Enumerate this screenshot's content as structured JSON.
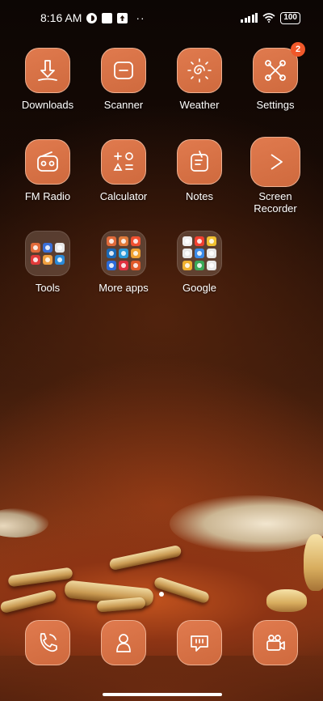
{
  "status_bar": {
    "time": "8:16 AM",
    "notification_icons": [
      "data-saver-icon",
      "gallery-icon",
      "upload-icon"
    ],
    "more_indicator": "··",
    "battery": "100"
  },
  "apps": [
    {
      "label": "Downloads",
      "icon": "download-icon"
    },
    {
      "label": "Scanner",
      "icon": "scanner-icon"
    },
    {
      "label": "Weather",
      "icon": "sun-icon"
    },
    {
      "label": "Settings",
      "icon": "settings-icon",
      "badge": "2"
    },
    {
      "label": "FM Radio",
      "icon": "radio-icon"
    },
    {
      "label": "Calculator",
      "icon": "calculator-icon"
    },
    {
      "label": "Notes",
      "icon": "notes-icon"
    },
    {
      "label": "Screen\nRecorder",
      "icon": "play-icon"
    }
  ],
  "folders": [
    {
      "label": "Tools",
      "colors": [
        "#e06a3a",
        "#3a6fd8",
        "#e8e8e8",
        "#e03a3a",
        "#f0a040",
        "#2a8ad8"
      ]
    },
    {
      "label": "More apps",
      "colors": [
        "#e06a3a",
        "#e07a3a",
        "#f05030",
        "#1a6ab8",
        "#2a9ad8",
        "#f0a030",
        "#2a6ad8",
        "#e03040",
        "#e05a2a"
      ]
    },
    {
      "label": "Google",
      "colors": [
        "#f0f0f0",
        "#f04030",
        "#f0c030",
        "#e8e8e8",
        "#3a8ae8",
        "#e8e8e8",
        "#f0b030",
        "#3aa858",
        "#e8e8e8"
      ]
    }
  ],
  "dock": [
    {
      "icon": "phone-icon"
    },
    {
      "icon": "contacts-icon"
    },
    {
      "icon": "messages-icon"
    },
    {
      "icon": "camera-icon"
    }
  ],
  "colors": {
    "icon_bg": "#d9714a",
    "badge": "#f0582a"
  }
}
